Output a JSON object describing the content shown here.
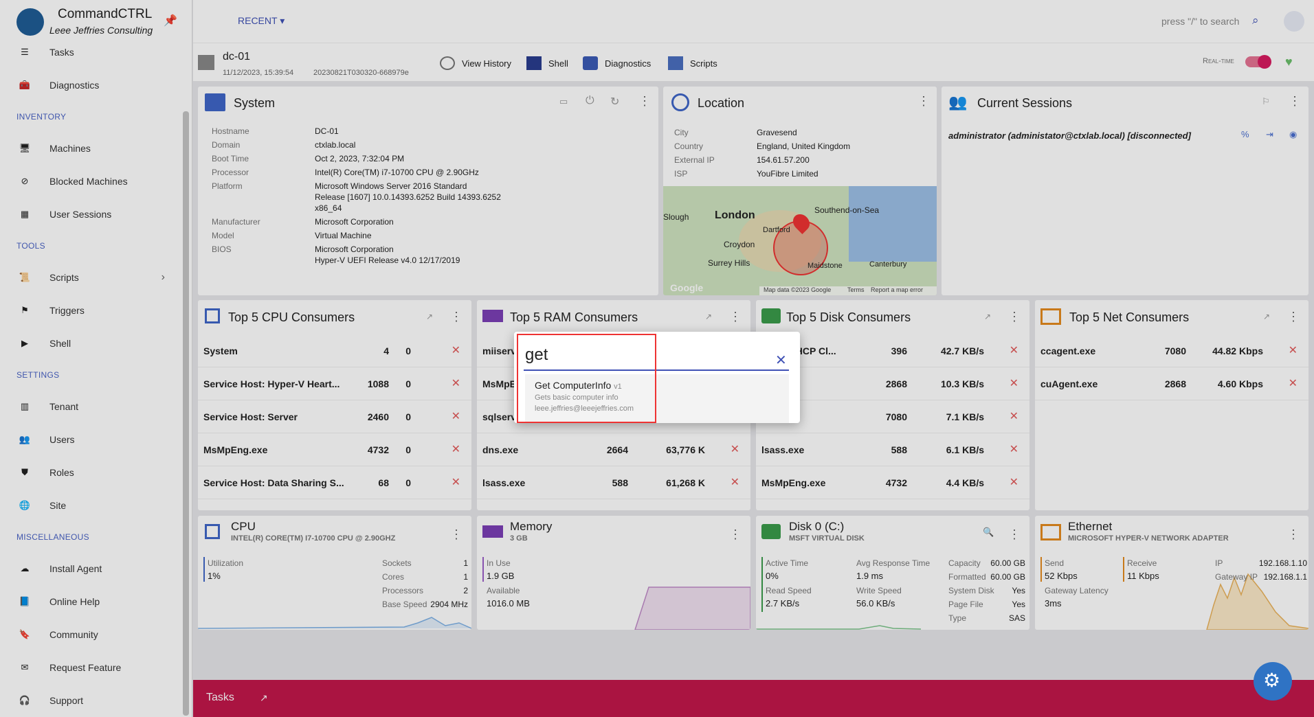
{
  "sidebar": {
    "app": "CommandCTRL",
    "tenant": "Leee Jeffries Consulting",
    "items": {
      "tasks": "Tasks",
      "diagnostics": "Diagnostics",
      "machines": "Machines",
      "blocked": "Blocked Machines",
      "sessions": "User Sessions",
      "scripts": "Scripts",
      "triggers": "Triggers",
      "shell": "Shell",
      "tenant": "Tenant",
      "users": "Users",
      "roles": "Roles",
      "site": "Site",
      "install": "Install Agent",
      "help": "Online Help",
      "community": "Community",
      "request": "Request Feature",
      "support": "Support"
    },
    "sections": {
      "inventory": "INVENTORY",
      "tools": "TOOLS",
      "settings": "SETTINGS",
      "misc": "MISCELLANEOUS"
    }
  },
  "header": {
    "recent": "RECENT",
    "search_hint": "press \"/\" to search"
  },
  "machine": {
    "name": "dc-01",
    "date": "11/12/2023, 15:39:54",
    "id": "20230821T030320-668979e",
    "actions": {
      "history": "View History",
      "shell": "Shell",
      "diag": "Diagnostics",
      "scripts": "Scripts"
    },
    "realtime": "Real-time"
  },
  "system": {
    "title": "System",
    "labels": {
      "hostname": "Hostname",
      "domain": "Domain",
      "boot": "Boot Time",
      "processor": "Processor",
      "platform": "Platform",
      "manufacturer": "Manufacturer",
      "model": "Model",
      "bios": "BIOS"
    },
    "values": {
      "hostname": "DC-01",
      "domain": "ctxlab.local",
      "boot": "Oct 2, 2023, 7:32:04 PM",
      "processor": "Intel(R) Core(TM) i7-10700 CPU @ 2.90GHz",
      "platform1": "Microsoft Windows Server 2016 Standard",
      "platform2": "Release [1607] 10.0.14393.6252 Build 14393.6252",
      "platform3": "x86_64",
      "manufacturer": "Microsoft Corporation",
      "model": "Virtual Machine",
      "bios1": "Microsoft Corporation",
      "bios2": "Hyper-V UEFI Release v4.0 12/17/2019"
    }
  },
  "location": {
    "title": "Location",
    "labels": {
      "city": "City",
      "country": "Country",
      "ip": "External IP",
      "isp": "ISP"
    },
    "values": {
      "city": "Gravesend",
      "country": "England, United Kingdom",
      "ip": "154.61.57.200",
      "isp": "YouFibre Limited"
    },
    "map": {
      "london": "London",
      "southend": "Southend-on-Sea",
      "dartford": "Dartford",
      "croydon": "Croydon",
      "slough": "Slough",
      "maidstone": "Maidstone",
      "canterbury": "Canterbury",
      "surrey": "Surrey Hills",
      "credit": "Map data ©2023 Google",
      "terms": "Terms",
      "report": "Report a map error",
      "google": "Google"
    }
  },
  "sessions": {
    "title": "Current Sessions",
    "entry": "administrator (administator@ctxlab.local) [disconnected]"
  },
  "cpu_top": {
    "title": "Top 5 CPU Consumers",
    "rows": [
      [
        "System",
        "4",
        "0"
      ],
      [
        "Service Host: Hyper-V Heart...",
        "1088",
        "0"
      ],
      [
        "Service Host: Server",
        "2460",
        "0"
      ],
      [
        "MsMpEng.exe",
        "4732",
        "0"
      ],
      [
        "Service Host: Data Sharing S...",
        "68",
        "0"
      ]
    ]
  },
  "ram_top": {
    "title": "Top 5 RAM Consumers",
    "rows": [
      [
        "miiserv",
        "",
        ""
      ],
      [
        "MsMpE...",
        "",
        ""
      ],
      [
        "sqlservr.e",
        "",
        ""
      ],
      [
        "dns.exe",
        "2664",
        "63,776 K"
      ],
      [
        "lsass.exe",
        "588",
        "61,268 K"
      ]
    ]
  },
  "disk_top": {
    "title": "Top 5 Disk Consumers",
    "rows": [
      [
        "Host: DHCP Cl...",
        "396",
        "42.7 KB/s"
      ],
      [
        ".exe",
        "2868",
        "10.3 KB/s"
      ],
      [
        "ent.exe",
        "7080",
        "7.1 KB/s"
      ],
      [
        "lsass.exe",
        "588",
        "6.1 KB/s"
      ],
      [
        "MsMpEng.exe",
        "4732",
        "4.4 KB/s"
      ]
    ]
  },
  "net_top": {
    "title": "Top 5 Net Consumers",
    "rows": [
      [
        "ccagent.exe",
        "7080",
        "44.82 Kbps"
      ],
      [
        "cuAgent.exe",
        "2868",
        "4.60 Kbps"
      ]
    ]
  },
  "cpu": {
    "title": "CPU",
    "sub": "INTEL(R) CORE(TM) I7-10700 CPU @ 2.90GHZ",
    "util_l": "Utilization",
    "util": "1%",
    "sockets_l": "Sockets",
    "sockets": "1",
    "cores_l": "Cores",
    "cores": "1",
    "procs_l": "Processors",
    "procs": "2",
    "speed_l": "Base Speed",
    "speed": "2904 MHz"
  },
  "memory": {
    "title": "Memory",
    "sub": "3 GB",
    "inuse_l": "In Use",
    "inuse": "1.9 GB",
    "avail_l": "Available",
    "avail": "1016.0 MB"
  },
  "disk": {
    "title": "Disk 0 (C:)",
    "sub": "MSFT VIRTUAL DISK",
    "active_l": "Active Time",
    "active": "0%",
    "resp_l": "Avg Response Time",
    "resp": "1.9 ms",
    "cap_l": "Capacity",
    "cap": "60.00 GB",
    "fmt_l": "Formatted",
    "fmt": "60.00 GB",
    "read_l": "Read Speed",
    "read": "2.7 KB/s",
    "write_l": "Write Speed",
    "write": "56.0 KB/s",
    "sys_l": "System Disk",
    "sys": "Yes",
    "page_l": "Page File",
    "page": "Yes",
    "type_l": "Type",
    "type": "SAS"
  },
  "ethernet": {
    "title": "Ethernet",
    "sub": "MICROSOFT HYPER-V NETWORK ADAPTER",
    "send_l": "Send",
    "send": "52 Kbps",
    "recv_l": "Receive",
    "recv": "11 Kbps",
    "ip_l": "IP",
    "ip": "192.168.1.10",
    "gw_l": "Gateway IP",
    "gw": "192.168.1.1",
    "lat_l": "Gateway Latency",
    "lat": "3ms"
  },
  "dialog": {
    "query": "get",
    "sugg_title": "Get ComputerInfo",
    "sugg_ver": "v1",
    "sugg_desc": "Gets basic computer info",
    "sugg_author": "leee.jeffries@leeejeffries.com"
  },
  "tasks_bar": {
    "label": "Tasks"
  },
  "colors": {
    "accent": "#3f51b5",
    "tasks": "#c2174a",
    "kill": "#e25a5a",
    "highlight": "#e33333"
  }
}
